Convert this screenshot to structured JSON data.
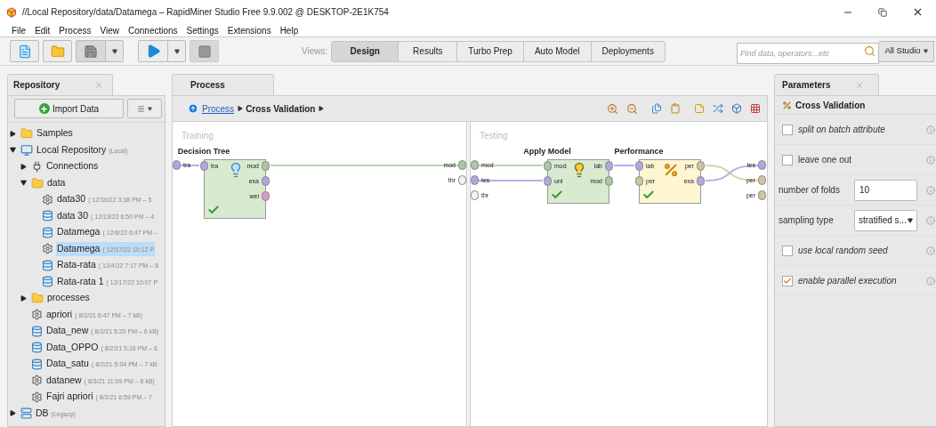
{
  "window": {
    "title": "//Local Repository/data/Datamega – RapidMiner Studio Free 9.9.002 @ DESKTOP-2E1K754"
  },
  "menu": [
    "File",
    "Edit",
    "Process",
    "View",
    "Connections",
    "Settings",
    "Extensions",
    "Help"
  ],
  "toolbar": {
    "views_label": "Views:",
    "views": [
      {
        "label": "Design",
        "selected": true
      },
      {
        "label": "Results",
        "selected": false
      },
      {
        "label": "Turbo Prep",
        "selected": false
      },
      {
        "label": "Auto Model",
        "selected": false
      },
      {
        "label": "Deployments",
        "selected": false
      }
    ],
    "search": {
      "placeholder": "Find data, operators...etc"
    },
    "scope": "All Studio"
  },
  "repository": {
    "tab": "Repository",
    "import_button": "Import Data",
    "tree": [
      {
        "kind": "folder",
        "name": "Samples",
        "expanded": false,
        "selected": false
      },
      {
        "kind": "repository",
        "name": "Local Repository",
        "meta": "(Local)",
        "expanded": true,
        "selected": false,
        "children": [
          {
            "kind": "connections",
            "name": "Connections",
            "expanded": false,
            "selected": false
          },
          {
            "kind": "folder",
            "name": "data",
            "expanded": true,
            "selected": false,
            "children": [
              {
                "kind": "process",
                "name": "data30",
                "meta": "( 12/16/22 3:38 PM – 5",
                "selected": false
              },
              {
                "kind": "data",
                "name": "data 30",
                "meta": "( 12/13/22 6:50 PM – 4",
                "selected": false
              },
              {
                "kind": "data",
                "name": "Datamega",
                "meta": "( 12/6/22 6:47 PM –",
                "selected": false
              },
              {
                "kind": "process",
                "name": "Datamega",
                "meta": "( 12/17/22 10:12 P",
                "selected": true
              },
              {
                "kind": "data",
                "name": "Rata-rata",
                "meta": "( 12/4/22 7:17 PM – 8",
                "selected": false
              },
              {
                "kind": "data",
                "name": "Rata-rata 1",
                "meta": "( 12/17/22 10:07 P",
                "selected": false
              }
            ]
          },
          {
            "kind": "folder",
            "name": "processes",
            "expanded": false,
            "selected": false
          },
          {
            "kind": "process",
            "name": "apriori",
            "meta": "( 8/2/21 6:47 PM – 7 kB)",
            "selected": false
          },
          {
            "kind": "data",
            "name": "Data_new",
            "meta": "( 8/2/21 5:20 PM – 6 kB)",
            "selected": false
          },
          {
            "kind": "data",
            "name": "Data_OPPO",
            "meta": "( 8/2/21 5:16 PM – 6",
            "selected": false
          },
          {
            "kind": "data",
            "name": "Data_satu",
            "meta": "( 8/2/21 5:04 PM – 7 kB",
            "selected": false
          },
          {
            "kind": "process",
            "name": "datanew",
            "meta": "( 8/3/21 11:09 PM – 6 kB)",
            "selected": false
          },
          {
            "kind": "process",
            "name": "Fajri apriori",
            "meta": "( 8/2/21 6:59 PM – 7",
            "selected": false
          }
        ]
      },
      {
        "kind": "database",
        "name": "DB",
        "meta": "(Legacy)",
        "expanded": false,
        "selected": false
      }
    ]
  },
  "process": {
    "tab": "Process",
    "breadcrumb": [
      "Process",
      "Cross Validation"
    ],
    "subprocesses": [
      {
        "title": "Training",
        "inputs": [
          {
            "label": "tra",
            "color": "#b3a6e0"
          }
        ],
        "outputs": [
          {
            "label": "mod",
            "color": "#a8c9a0"
          },
          {
            "label": "thr",
            "color": "#f2f2f2"
          }
        ],
        "operators": [
          {
            "name": "Decision Tree",
            "kind": "learner",
            "ok": true,
            "ports_in": [
              {
                "label": "tra",
                "color": "#b3a6e0"
              }
            ],
            "ports_out": [
              {
                "label": "mod",
                "color": "#a8c9a0"
              },
              {
                "label": "exa",
                "color": "#b3a6e0"
              },
              {
                "label": "wei",
                "color": "#d99ac8"
              }
            ]
          }
        ]
      },
      {
        "title": "Testing",
        "inputs": [
          {
            "label": "mod",
            "color": "#a8c9a0"
          },
          {
            "label": "tes",
            "color": "#b3a6e0"
          },
          {
            "label": "thr",
            "color": "#f2f2f2"
          }
        ],
        "outputs": [
          {
            "label": "tes",
            "color": "#b3a6e0"
          },
          {
            "label": "per",
            "color": "#cfc4a0"
          },
          {
            "label": "per",
            "color": "#cfc4a0"
          }
        ],
        "operators": [
          {
            "name": "Apply Model",
            "kind": "apply",
            "ok": true,
            "ports_in": [
              {
                "label": "mod",
                "color": "#a8c9a0"
              },
              {
                "label": "unl",
                "color": "#b3a6e0"
              }
            ],
            "ports_out": [
              {
                "label": "lab",
                "color": "#b3a6e0"
              },
              {
                "label": "mod",
                "color": "#a8c9a0"
              }
            ]
          },
          {
            "name": "Performance",
            "kind": "performance",
            "ok": true,
            "ports_in": [
              {
                "label": "lab",
                "color": "#b3a6e0"
              },
              {
                "label": "per",
                "color": "#cfc4a0"
              }
            ],
            "ports_out": [
              {
                "label": "per",
                "color": "#cfc4a0"
              },
              {
                "label": "exa",
                "color": "#b3a6e0"
              }
            ]
          }
        ]
      }
    ]
  },
  "parameters": {
    "tab": "Parameters",
    "operator": "Cross Validation",
    "items": [
      {
        "kind": "checkbox",
        "label": "split on batch attribute",
        "expert": true,
        "checked": false
      },
      {
        "kind": "checkbox",
        "label": "leave one out",
        "expert": false,
        "checked": false
      },
      {
        "kind": "number",
        "label": "number of folds",
        "value": "10"
      },
      {
        "kind": "select",
        "label": "sampling type",
        "value": "stratified s..."
      },
      {
        "kind": "checkbox",
        "label": "use local random seed",
        "expert": true,
        "checked": false
      },
      {
        "kind": "checkbox",
        "label": "enable parallel execution",
        "expert": true,
        "checked": true
      }
    ]
  }
}
